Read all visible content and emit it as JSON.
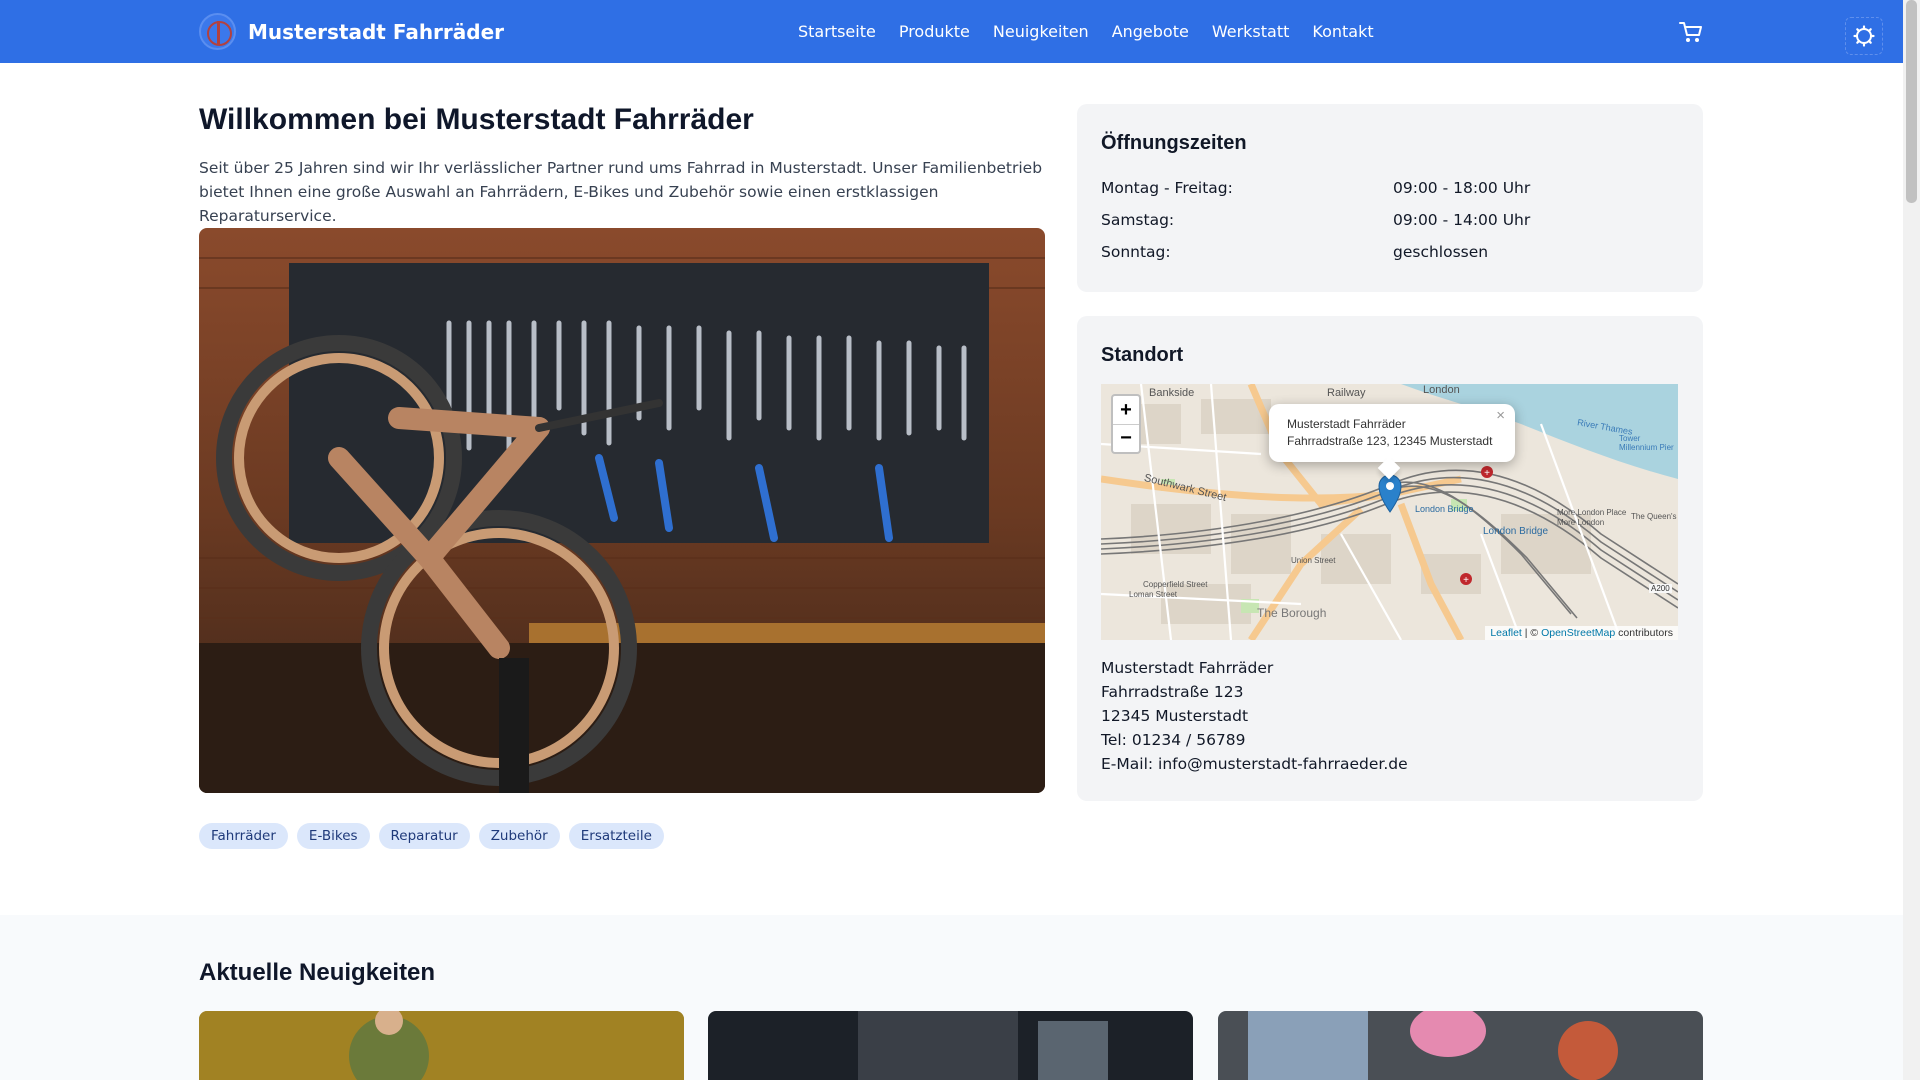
{
  "header": {
    "brand_name": "Musterstadt Fahrräder",
    "nav": [
      "Startseite",
      "Produkte",
      "Neuigkeiten",
      "Angebote",
      "Werkstatt",
      "Kontakt"
    ],
    "accent_color": "#2f6fe5"
  },
  "hero": {
    "title": "Willkommen bei Musterstadt Fahrräder",
    "text": "Seit über 25 Jahren sind wir Ihr verlässlicher Partner rund ums Fahrrad in Musterstadt. Unser Familienbetrieb bietet Ihnen eine große Auswahl an Fahrrädern, E-Bikes und Zubehör sowie einen erstklassigen Reparaturservice.",
    "tags": [
      "Fahrräder",
      "E-Bikes",
      "Reparatur",
      "Zubehör",
      "Ersatzteile"
    ]
  },
  "hours": {
    "title": "Öffnungszeiten",
    "rows": [
      {
        "day": "Montag - Freitag:",
        "time": "09:00 - 18:00 Uhr"
      },
      {
        "day": "Samstag:",
        "time": "09:00 - 14:00 Uhr"
      },
      {
        "day": "Sonntag:",
        "time": "geschlossen"
      }
    ]
  },
  "location": {
    "title": "Standort",
    "map": {
      "zoom_in": "+",
      "zoom_out": "−",
      "popup_name": "Musterstadt Fahrräder",
      "popup_address": "Fahrradstraße 123, 12345 Musterstadt",
      "popup_close": "×",
      "labels": [
        "Bankside",
        "Railway",
        "London",
        "Southwark Street",
        "London Bridge",
        "London Bridge",
        "More London Place",
        "More London",
        "Union Street",
        "Copperfield Street",
        "Loman Street",
        "The Borough",
        "A200",
        "River Thames",
        "Tower Millennium Pier",
        "The Queen's"
      ],
      "attribution_leaflet": "Leaflet",
      "attribution_sep": " | © ",
      "attribution_osm": "OpenStreetMap",
      "attribution_tail": " contributors"
    },
    "address": {
      "name": "Musterstadt Fahrräder",
      "street": "Fahrradstraße 123",
      "city": "12345 Musterstadt",
      "phone": "Tel: 01234 / 56789",
      "email": "E-Mail: info@musterstadt-fahrraeder.de"
    }
  },
  "news": {
    "title": "Aktuelle Neuigkeiten"
  }
}
